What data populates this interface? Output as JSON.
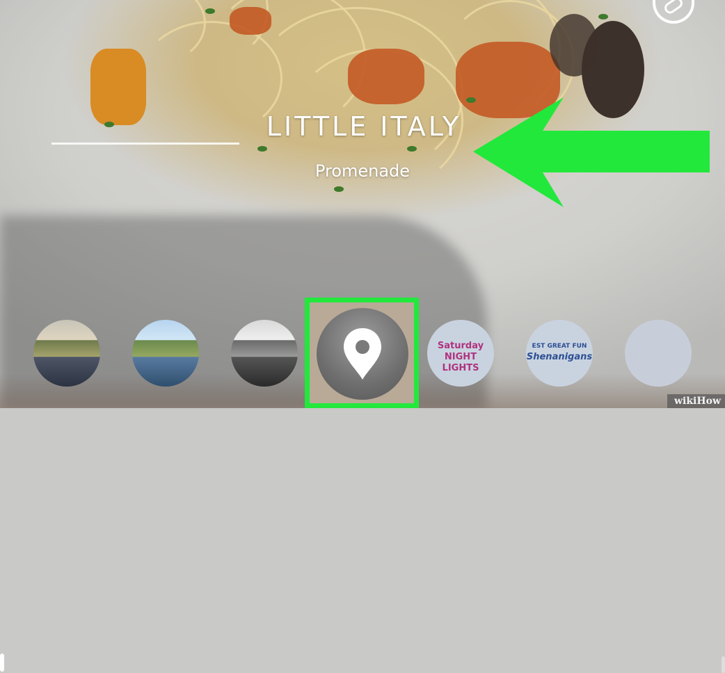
{
  "story": {
    "location_title": "LITTLE ITALY",
    "location_subtitle": "Promenade"
  },
  "toolbar": {
    "link_icon": "link-icon"
  },
  "filters": {
    "items": [
      {
        "name": "landscape-warm-filter"
      },
      {
        "name": "landscape-vivid-filter"
      },
      {
        "name": "landscape-mono-filter"
      },
      {
        "name": "geofilter-location",
        "icon": "location-pin-icon"
      },
      {
        "name": "sticker-filter-a",
        "text_lines": [
          "Saturday",
          "NIGHT LIGHTS"
        ]
      },
      {
        "name": "sticker-filter-b",
        "text_lines": [
          "EST GREAT FUN",
          "Shenanigans"
        ]
      },
      {
        "name": "blank-filter"
      }
    ],
    "highlight_color": "#22e83c"
  },
  "annotation": {
    "arrow_color": "#22e83c"
  },
  "watermark": "wikiHow"
}
